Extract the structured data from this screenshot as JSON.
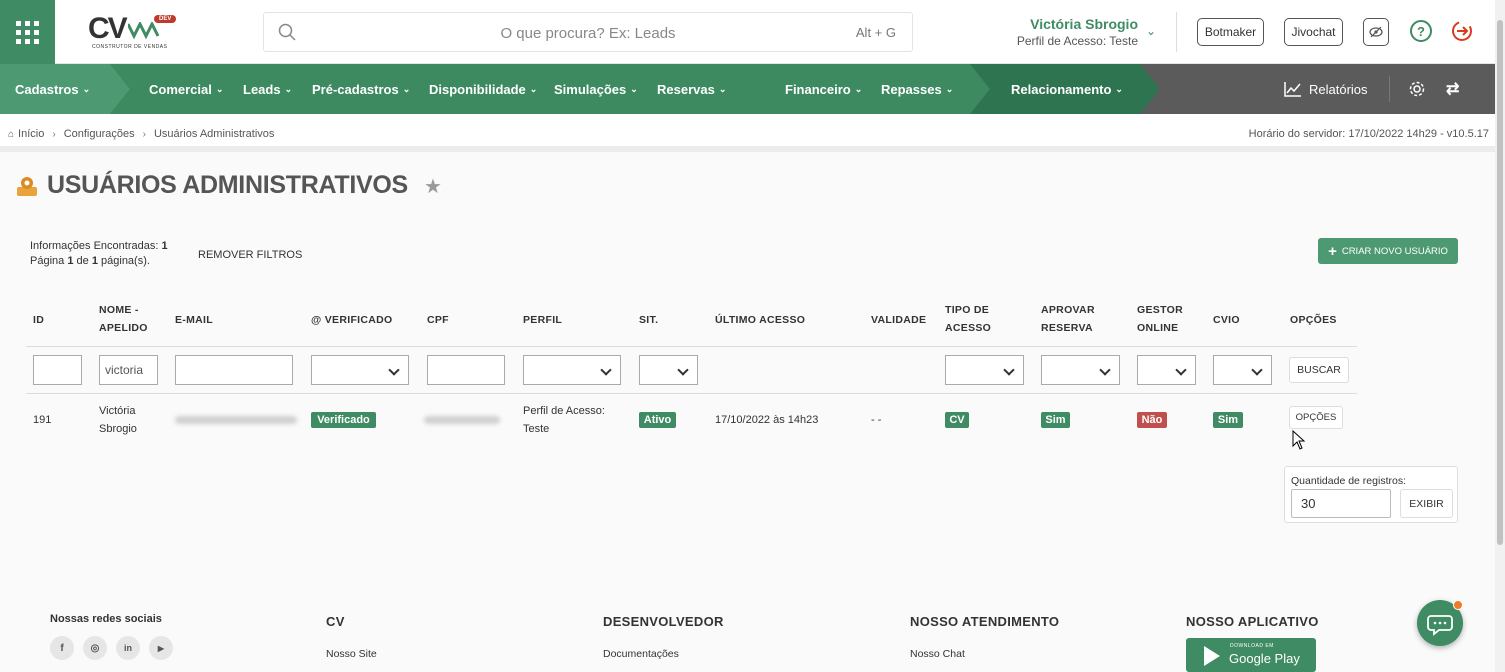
{
  "header": {
    "logo_text": "CV",
    "logo_badge": "DEV",
    "logo_subtitle": "CONSTRUTOR DE VENDAS",
    "search_placeholder": "O que procura? Ex: Leads",
    "search_shortcut": "Alt + G",
    "user_name": "Victória Sbrogio",
    "user_profile": "Perfil de Acesso: Teste",
    "btn_botmaker": "Botmaker",
    "btn_jivochat": "Jivochat",
    "colors": {
      "brand": "#3f8b63",
      "danger": "#d93b1e"
    }
  },
  "nav": {
    "items": [
      {
        "label": "Cadastros"
      },
      {
        "label": "Comercial"
      },
      {
        "label": "Leads"
      },
      {
        "label": "Pré-cadastros"
      },
      {
        "label": "Disponibilidade"
      },
      {
        "label": "Simulações"
      },
      {
        "label": "Reservas"
      },
      {
        "label": "Financeiro"
      },
      {
        "label": "Repasses"
      },
      {
        "label": "Relacionamento"
      }
    ],
    "reports_label": "Relatórios",
    "colors": {
      "seg1": "#4d9a72",
      "seg2": "#3d8a61",
      "seg3": "#2f7450",
      "rest": "#5b5b5b"
    }
  },
  "breadcrumb": {
    "items": [
      "Início",
      "Configurações",
      "Usuários Administrativos"
    ],
    "server_time": "Horário do servidor: 17/10/2022 14h29 - v10.5.17"
  },
  "page": {
    "title": "USUÁRIOS ADMINISTRATIVOS",
    "info_label1": "Informações Encontradas:",
    "info_count": "1",
    "info_page_prefix": "Página",
    "info_page": "1",
    "info_page_of": "de",
    "info_pages": "1",
    "info_pages_suffix": "página(s).",
    "remove_filters": "REMOVER FILTROS",
    "create_user": "CRIAR NOVO USUÁRIO"
  },
  "table": {
    "headers": [
      "ID",
      "NOME - APELIDO",
      "E-MAIL",
      "@ VERIFICADO",
      "CPF",
      "PERFIL",
      "SIT.",
      "ÚLTIMO ACESSO",
      "VALIDADE",
      "TIPO DE ACESSO",
      "APROVAR RESERVA",
      "GESTOR ONLINE",
      "CVIO",
      "OPÇÕES"
    ],
    "filter_name_value": "victoria",
    "search_button": "BUSCAR",
    "rows": [
      {
        "id": "191",
        "name_line1": "Victória",
        "name_line2": "Sbrogio",
        "verified": "Verificado",
        "profile_line1": "Perfil de Acesso:",
        "profile_line2": "Teste",
        "status": "Ativo",
        "last_access": "17/10/2022 às 14h23",
        "validity": "- -",
        "access_type": "CV",
        "approve_reservation": "Sim",
        "online_manager": "Não",
        "cvio": "Sim",
        "options": "OPÇÕES"
      }
    ],
    "badge_colors": {
      "green": "#3f8b63",
      "red": "#c0504d"
    }
  },
  "quantity": {
    "label": "Quantidade de registros:",
    "value": "30",
    "button": "EXIBIR"
  },
  "footer": {
    "social_title": "Nossas redes sociais",
    "social_icons": [
      "f",
      "◎",
      "in",
      "▶"
    ],
    "cv_title": "CV",
    "cv_link": "Nosso Site",
    "dev_title": "DESENVOLVEDOR",
    "dev_link": "Documentações",
    "support_title": "NOSSO ATENDIMENTO",
    "support_link": "Nosso Chat",
    "app_title": "NOSSO APLICATIVO",
    "gplay_small": "DOWNLOAD EM",
    "gplay_big": "Google Play"
  }
}
